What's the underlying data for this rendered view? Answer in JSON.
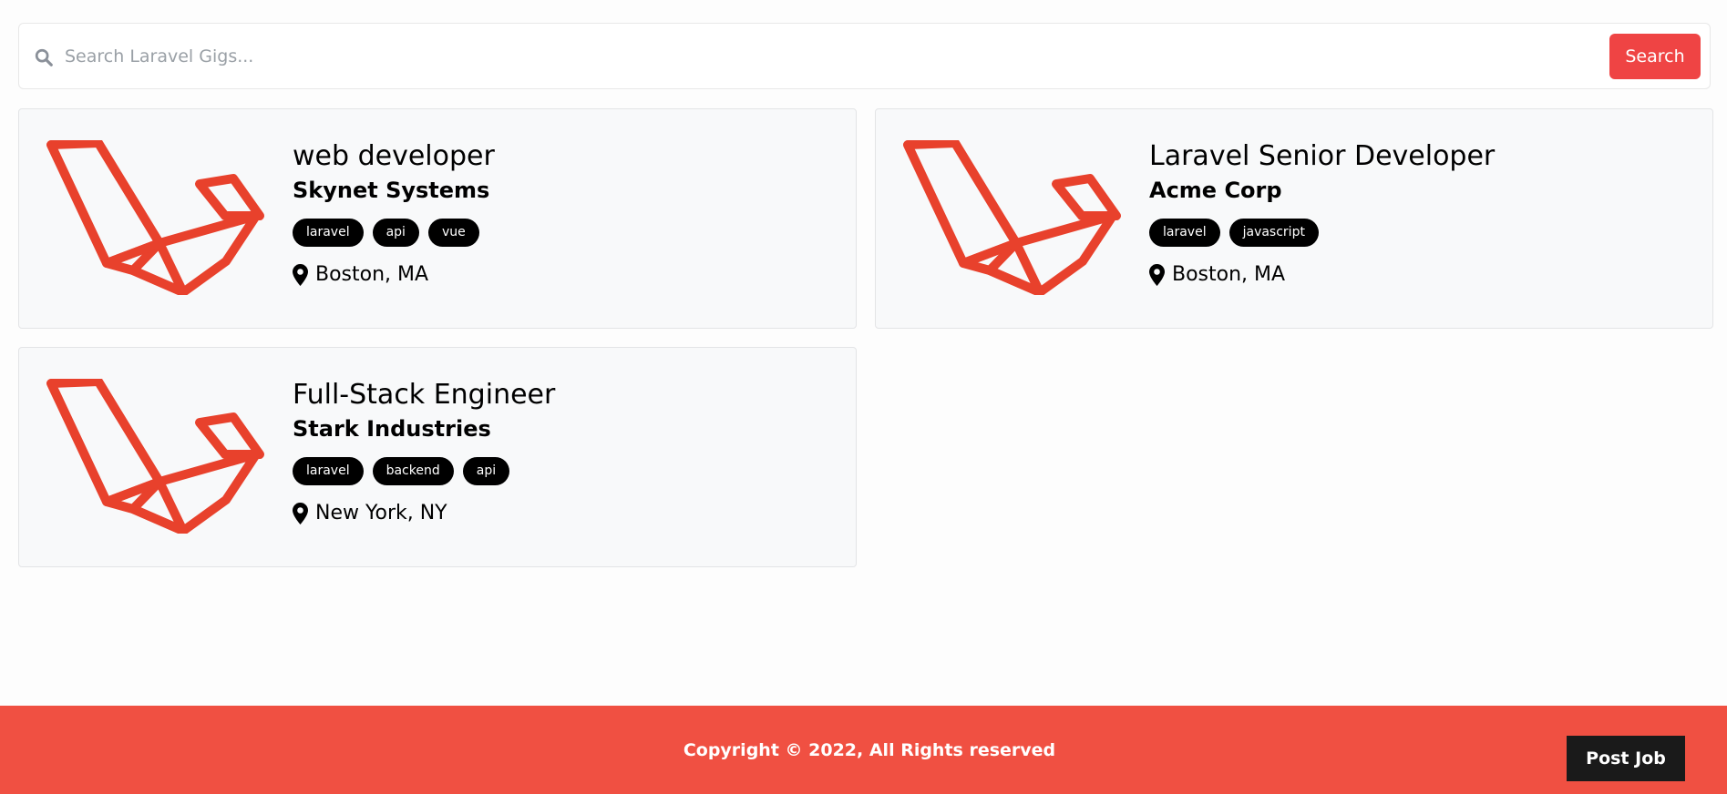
{
  "search": {
    "placeholder": "Search Laravel Gigs...",
    "button_label": "Search"
  },
  "listings": [
    {
      "title": "web developer",
      "company": "Skynet Systems",
      "tags": [
        "laravel",
        "api",
        "vue"
      ],
      "location": "Boston, MA"
    },
    {
      "title": "Laravel Senior Developer",
      "company": "Acme Corp",
      "tags": [
        "laravel",
        "javascript"
      ],
      "location": "Boston, MA"
    },
    {
      "title": "Full-Stack Engineer",
      "company": "Stark Industries",
      "tags": [
        "laravel",
        "backend",
        "api"
      ],
      "location": "New York, NY"
    }
  ],
  "footer": {
    "copyright": "Copyright © 2022, All Rights reserved",
    "post_job_label": "Post Job"
  },
  "colors": {
    "brand_red": "#ef4444",
    "footer_red": "#f05042",
    "logo_red": "#e8412c",
    "tag_bg": "#000000"
  },
  "icons": {
    "search": "search-icon",
    "location": "map-pin-icon",
    "logo": "laravel-logo"
  }
}
